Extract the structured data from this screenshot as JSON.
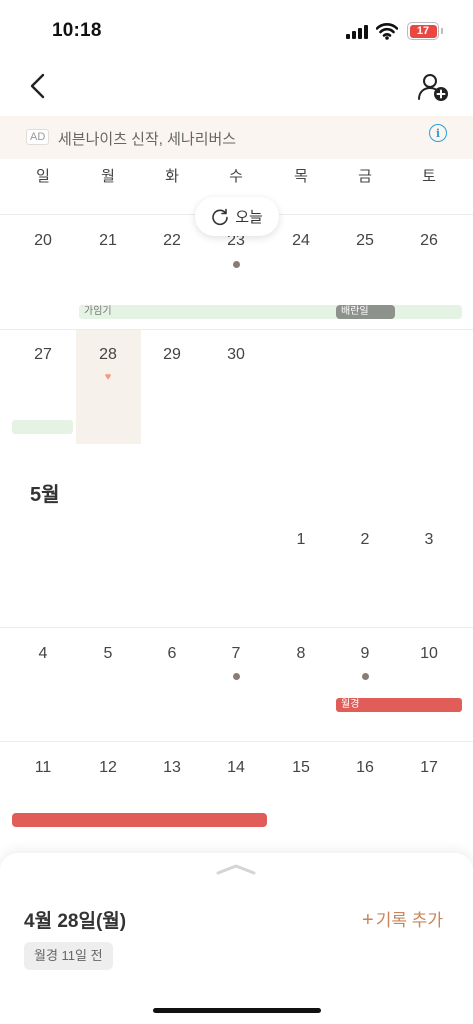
{
  "status": {
    "time": "10:18",
    "battery": "17",
    "battery_color": "#e9473f"
  },
  "ad": {
    "tag": "AD",
    "text": "세븐나이츠 신작, 세나리버스"
  },
  "weekdays": [
    "일",
    "월",
    "화",
    "수",
    "목",
    "금",
    "토"
  ],
  "today_button": {
    "label": "오늘",
    "icon": "refresh-icon"
  },
  "april": {
    "week1": [
      "20",
      "21",
      "22",
      "23",
      "24",
      "25",
      "26"
    ],
    "week2": [
      "27",
      "28",
      "29",
      "30"
    ],
    "labels": {
      "fertile": "가임기",
      "ovulation": "배란일"
    }
  },
  "may": {
    "title": "5월",
    "week1": [
      "1",
      "2",
      "3"
    ],
    "week2": [
      "4",
      "5",
      "6",
      "7",
      "8",
      "9",
      "10"
    ],
    "week3": [
      "11",
      "12",
      "13",
      "14",
      "15",
      "16",
      "17"
    ],
    "labels": {
      "period": "월경"
    }
  },
  "sheet": {
    "date": "4월 28일(월)",
    "add_record_plus": "+",
    "add_record_label": "기록 추가",
    "badge": "월경 11일 전"
  },
  "colors": {
    "accent": "#c8845a",
    "period": "#e05d58",
    "fertile": "#e5f3e5",
    "ovulation": "#8e928d",
    "heart": "#f29a83"
  }
}
